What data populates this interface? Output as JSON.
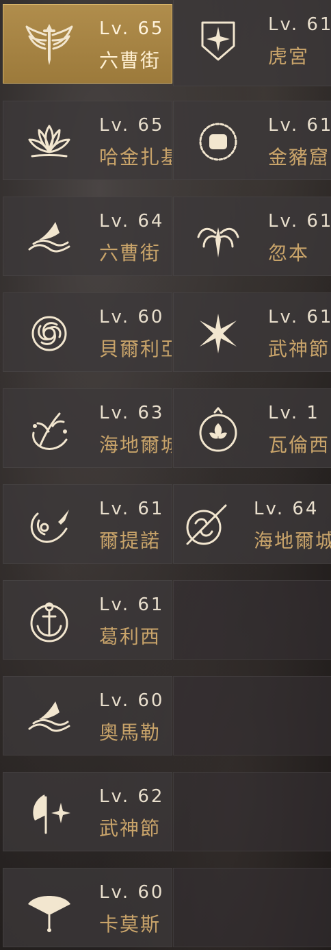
{
  "left_column": [
    {
      "level": "Lv. 65",
      "name": "六曹街",
      "icon": "sword-wings-icon",
      "selected": true
    },
    {
      "level": "Lv. 65",
      "name": "哈金扎基",
      "icon": "lotus-icon"
    },
    {
      "level": "Lv. 64",
      "name": "六曹街",
      "icon": "wave-hat-icon"
    },
    {
      "level": "Lv. 60",
      "name": "貝爾利亞",
      "icon": "rose-icon"
    },
    {
      "level": "Lv. 63",
      "name": "海地爾城",
      "icon": "wreath-branch-icon"
    },
    {
      "level": "Lv. 61",
      "name": "爾提諾",
      "icon": "horn-dagger-icon"
    },
    {
      "level": "Lv. 61",
      "name": "葛利西",
      "icon": "anchor-circle-icon"
    },
    {
      "level": "Lv. 60",
      "name": "奧馬勒",
      "icon": "wave-hat-icon"
    },
    {
      "level": "Lv. 62",
      "name": "武神節",
      "icon": "axe-star-icon"
    },
    {
      "level": "Lv. 60",
      "name": "卡莫斯",
      "icon": "fan-icon"
    }
  ],
  "right_column": [
    {
      "level": "Lv. 61",
      "name": "虎宮",
      "icon": "shield-star-icon"
    },
    {
      "level": "Lv. 61",
      "name": "金豬窟",
      "icon": "fist-circle-icon"
    },
    {
      "level": "Lv. 61",
      "name": "忽本",
      "icon": "spider-dagger-icon"
    },
    {
      "level": "Lv. 61",
      "name": "武神節",
      "icon": "star-lightning-icon"
    },
    {
      "level": "Lv. 1",
      "name": "瓦倫西",
      "icon": "flower-orb-icon"
    },
    {
      "level": "Lv. 64",
      "name": "海地爾城",
      "icon": "spear-swirl-icon"
    },
    {
      "empty": true
    },
    {
      "empty": true
    },
    {
      "empty": true
    },
    {
      "empty": true
    }
  ],
  "colors": {
    "selected_bg": "#b08d4c",
    "level_text": "#e9dfcd",
    "name_text": "#c9a46a",
    "icon": "#f2e6cf"
  }
}
